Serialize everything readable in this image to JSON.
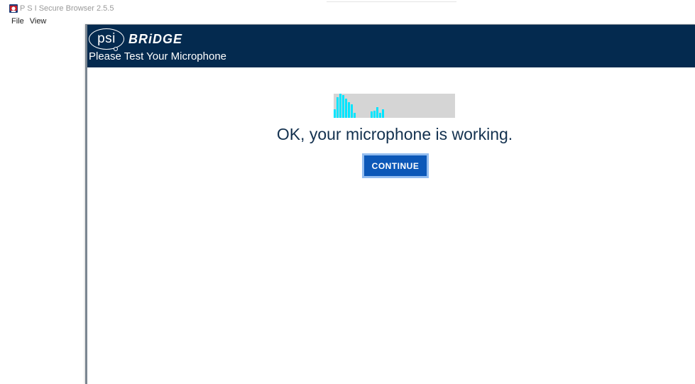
{
  "window": {
    "title": "P S I Secure Browser 2.5.5",
    "icon": "psi-app-icon"
  },
  "menu": {
    "items": [
      "File",
      "View"
    ]
  },
  "header": {
    "logo_psi": "psi",
    "logo_bridge": "BRiDGE",
    "subtitle": "Please Test Your Microphone",
    "background_color": "#042a4f"
  },
  "mic_meter": {
    "bar_color": "#00e5ff",
    "background_color": "#d5d5d5",
    "levels": [
      0.35,
      0.85,
      1.0,
      0.95,
      0.8,
      0.65,
      0.55,
      0.2,
      0,
      0,
      0,
      0,
      0,
      0.25,
      0.3,
      0.45,
      0.2,
      0.35
    ]
  },
  "main": {
    "status_message": "OK, your microphone is working.",
    "continue_label": "CONTINUE"
  }
}
